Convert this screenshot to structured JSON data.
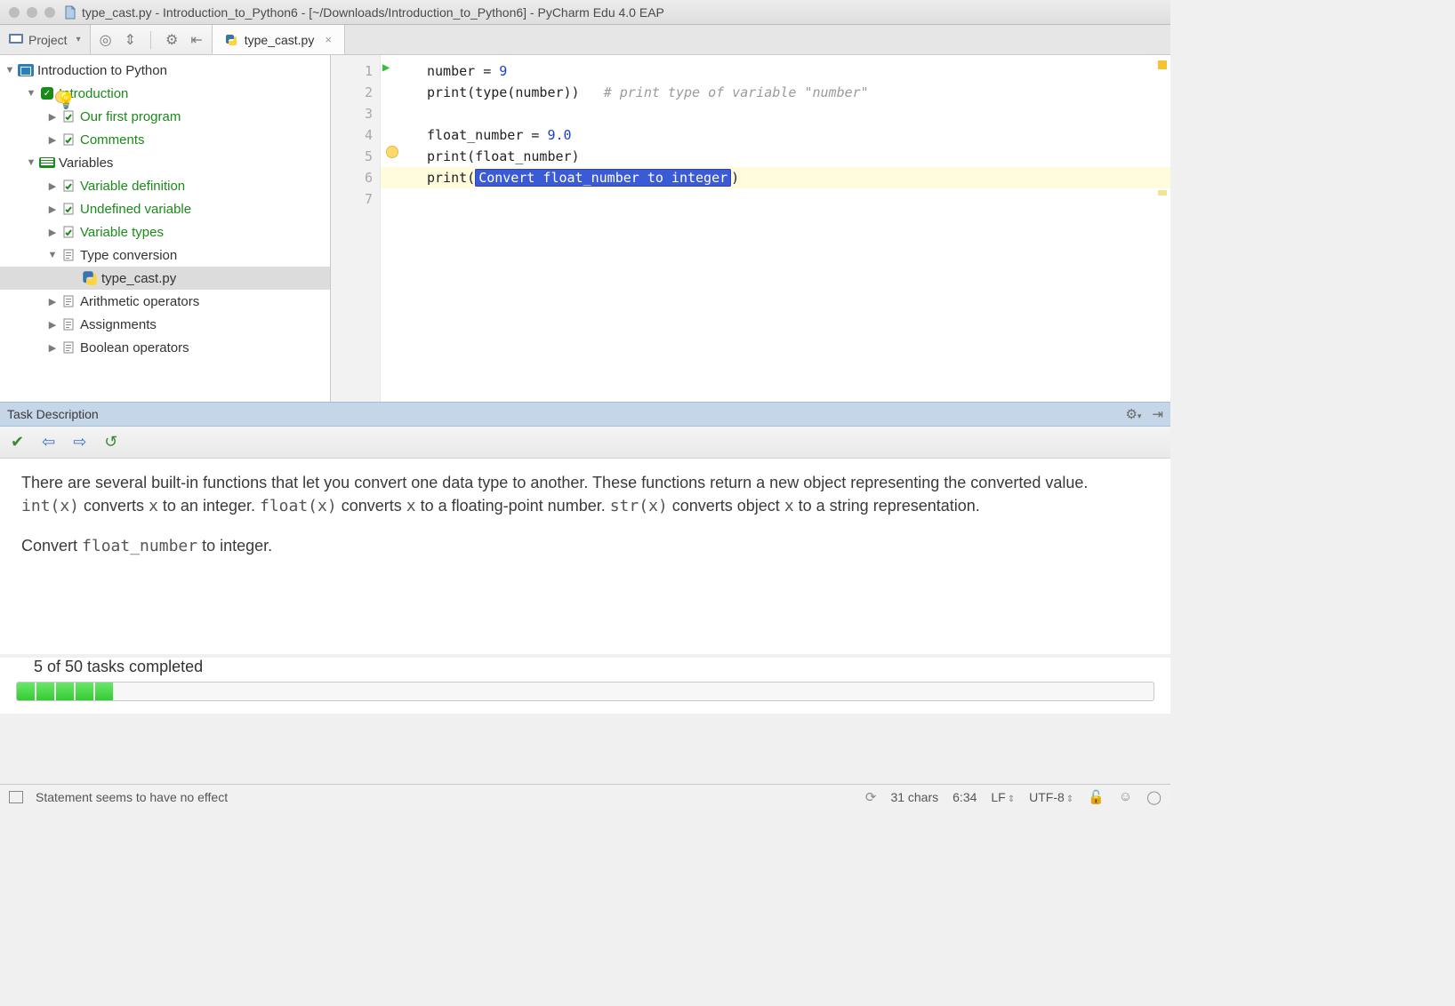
{
  "titlebar": {
    "filename": "type_cast.py",
    "project": "Introduction_to_Python6",
    "path": "[~/Downloads/Introduction_to_Python6]",
    "app": "PyCharm Edu 4.0 EAP",
    "full": "type_cast.py - Introduction_to_Python6 - [~/Downloads/Introduction_to_Python6] - PyCharm Edu 4.0 EAP"
  },
  "toolbar": {
    "project_label": "Project"
  },
  "editor_tab": {
    "label": "type_cast.py"
  },
  "tree": {
    "root": "Introduction to Python",
    "intro": "Introduction",
    "firstprog": "Our first program",
    "comments": "Comments",
    "variables": "Variables",
    "vardef": "Variable definition",
    "undef": "Undefined variable",
    "vartypes": "Variable types",
    "typeconv": "Type conversion",
    "typecast": "type_cast.py",
    "arith": "Arithmetic operators",
    "assign": "Assignments",
    "bool": "Boolean operators"
  },
  "code": {
    "l1a": "number = ",
    "l1b": "9",
    "l2a": "print",
    "l2b": "(type(number))",
    "l2c": "# print type of variable \"number\"",
    "l4a": "float_number = ",
    "l4b": "9.0",
    "l5a": "print",
    "l5b": "(float_number)",
    "l6a": "print",
    "l6b": "(",
    "l6ph": "Convert float_number to integer",
    "l6c": ")",
    "gutter": [
      "1",
      "2",
      "3",
      "4",
      "5",
      "6",
      "7"
    ]
  },
  "task": {
    "header": "Task Description",
    "para1a": "There are several built-in functions that let you convert one data type to another. These functions return a new object representing the converted value. ",
    "code1": "int(x)",
    "para1b": " converts ",
    "codex1": "x",
    "para1c": " to an integer. ",
    "code2": "float(x)",
    "para1d": " converts ",
    "codex2": "x",
    "para1e": " to a floating-point number. ",
    "code3": "str(x)",
    "para1f": " converts object ",
    "codex3": "x",
    "para1g": " to a string representation.",
    "para2a": "Convert ",
    "para2code": "float_number",
    "para2b": " to integer."
  },
  "progress": {
    "text": "5 of 50 tasks completed",
    "done": 5,
    "total": 50
  },
  "status": {
    "message": "Statement seems to have no effect",
    "chars": "31 chars",
    "pos": "6:34",
    "sep": "LF",
    "enc": "UTF-8"
  }
}
